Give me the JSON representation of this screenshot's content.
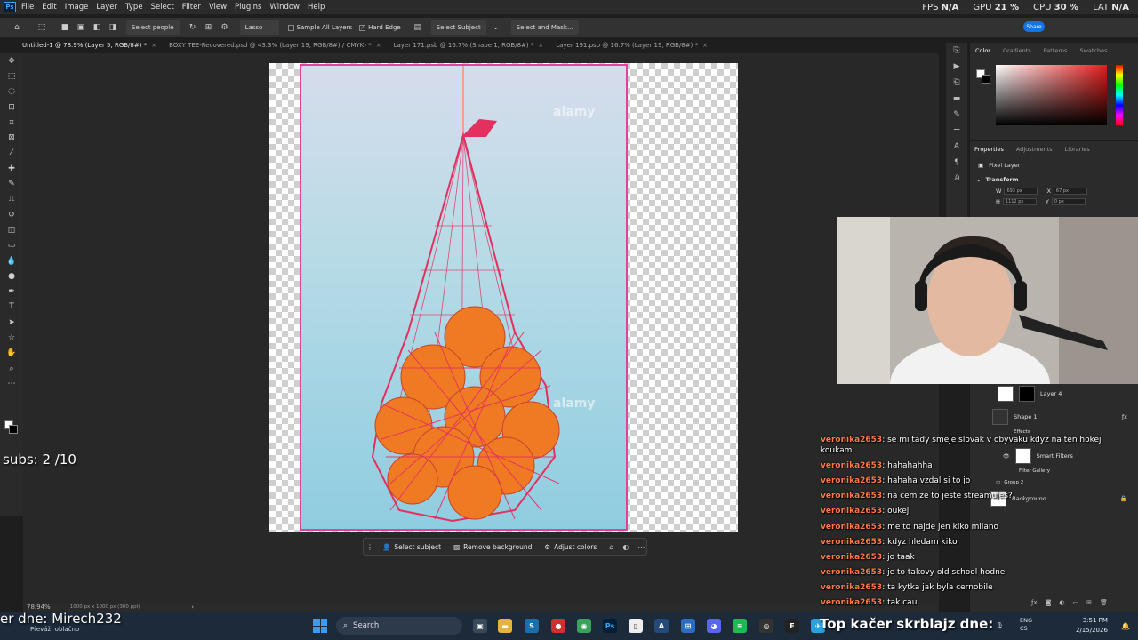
{
  "app": {
    "logo": "Ps",
    "menus": [
      "File",
      "Edit",
      "Image",
      "Layer",
      "Type",
      "Select",
      "Filter",
      "View",
      "Plugins",
      "Window",
      "Help"
    ]
  },
  "perf": {
    "fps_label": "FPS",
    "fps_value": "N/A",
    "gpu_label": "GPU",
    "gpu_value": "21 %",
    "cpu_label": "CPU",
    "cpu_value": "30 %",
    "lat_label": "LAT",
    "lat_value": "N/A"
  },
  "options": {
    "select_people": "Select people",
    "lasso": "Lasso",
    "sample_all_layers": "Sample All Layers",
    "hard_edge": "Hard Edge",
    "select_subject": "Select Subject",
    "select_and_mask": "Select and Mask...",
    "share": "Share"
  },
  "tabs": [
    {
      "label": "Untitled-1 @ 78.9% (Layer 5, RGB/8#) *",
      "active": true
    },
    {
      "label": "BOXY TEE-Recovered.psd @ 43.3% (Layer 19, RGB/8#) / CMYK) *",
      "active": false
    },
    {
      "label": "Layer 171.psb @ 16.7% (Shape 1, RGB/8#) *",
      "active": false
    },
    {
      "label": "Layer 191.psb @ 16.7% (Layer 19, RGB/8#) *",
      "active": false
    }
  ],
  "canvas": {
    "watermark": "alamy"
  },
  "contextbar": {
    "select_subject": "Select subject",
    "remove_background": "Remove background",
    "adjust_colors": "Adjust colors"
  },
  "status": {
    "zoom": "78.94%",
    "dims": "1000 px x 1000 px (300 ppi)"
  },
  "panels": {
    "color_tabs": [
      "Color",
      "Gradients",
      "Patterns",
      "Swatches"
    ],
    "props_tabs": [
      "Properties",
      "Adjustments",
      "Libraries"
    ],
    "pixel_layer": "Pixel Layer",
    "transform": "Transform",
    "w_label": "W",
    "w_value": "693 px",
    "x_label": "X",
    "x_value": "67 px",
    "h_label": "H",
    "h_value": "1112 px",
    "y_label": "Y",
    "y_value": "0 px"
  },
  "layers": [
    {
      "name": "Layer 4"
    },
    {
      "name": "Shape 1"
    },
    {
      "name": "Effects"
    },
    {
      "name": "Smart Filters"
    },
    {
      "name": "Filter Gallery"
    },
    {
      "name": "Group 2"
    },
    {
      "name": "Background"
    }
  ],
  "chat": [
    {
      "user": "veronika2653",
      "text": "se mi tady smeje slovak v obyvaku kdyz na ten hokej koukam"
    },
    {
      "user": "veronika2653",
      "text": "hahahahha"
    },
    {
      "user": "veronika2653",
      "text": "hahaha vzdal si to jo"
    },
    {
      "user": "veronika2653",
      "text": "na cem ze to jeste streamujes?"
    },
    {
      "user": "veronika2653",
      "text": "oukej"
    },
    {
      "user": "veronika2653",
      "text": "me to najde jen kiko milano"
    },
    {
      "user": "veronika2653",
      "text": "kdyz hledam kiko"
    },
    {
      "user": "veronika2653",
      "text": "jo taak"
    },
    {
      "user": "veronika2653",
      "text": "je to takovy old school hodne"
    },
    {
      "user": "veronika2653",
      "text": "ta kytka jak byla cernobile"
    },
    {
      "user": "veronika2653",
      "text": "tak cau"
    }
  ],
  "overlay": {
    "subs": "subs: 2 /10",
    "donor": "er dne: Mirech232",
    "top": "Top kačer skrblajz dne:"
  },
  "taskbar": {
    "weather": "Převáž. oblačno",
    "search": "Search",
    "lang_top": "ENG",
    "lang_bottom": "CS",
    "time": "3:51 PM",
    "date": "2/15/2026"
  }
}
